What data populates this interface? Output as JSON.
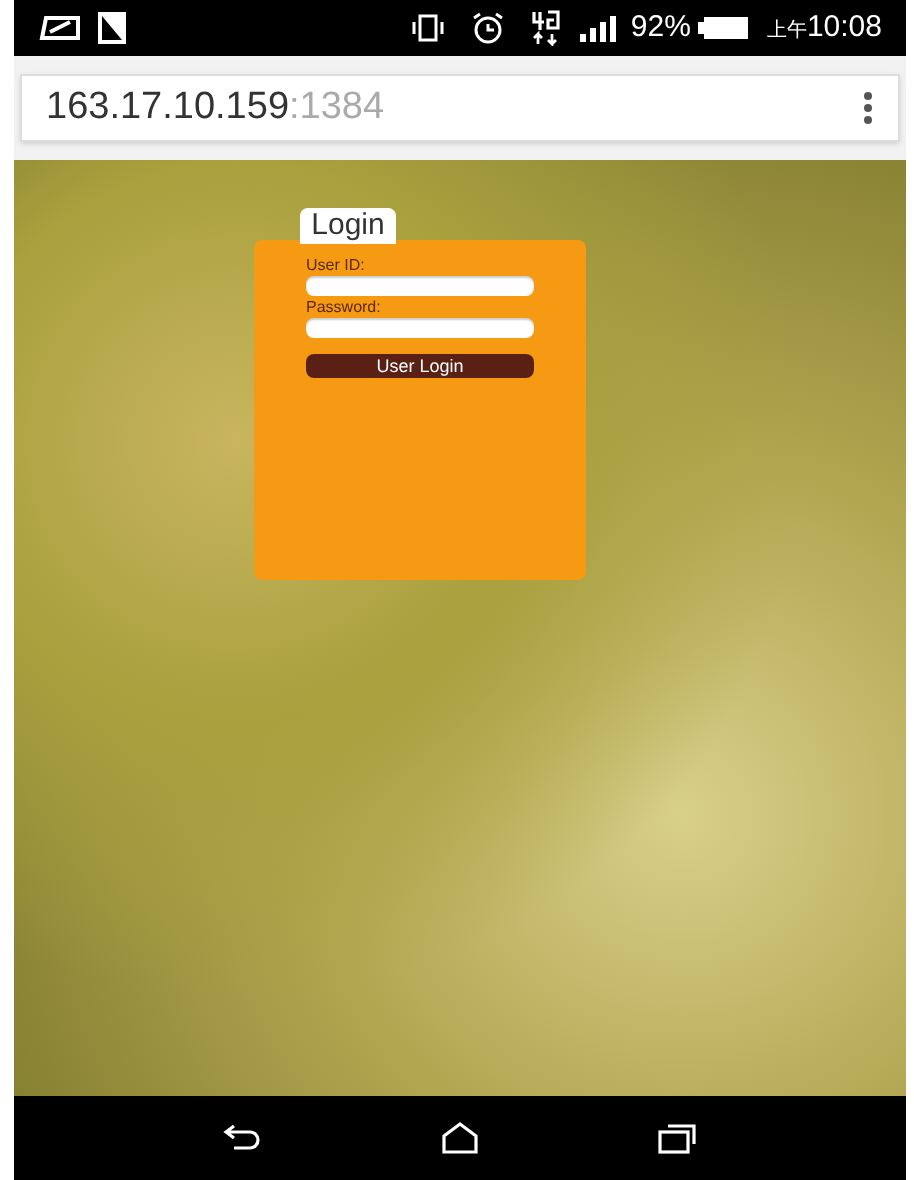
{
  "status_bar": {
    "battery": "92%",
    "time_prefix": "上午",
    "time": "10:08"
  },
  "address_bar": {
    "host": "163.17.10.159",
    "port": ":1384"
  },
  "login": {
    "tab": "Login",
    "fields": [
      {
        "label": "User ID:"
      },
      {
        "label": "Password:"
      }
    ],
    "button": "User Login"
  }
}
